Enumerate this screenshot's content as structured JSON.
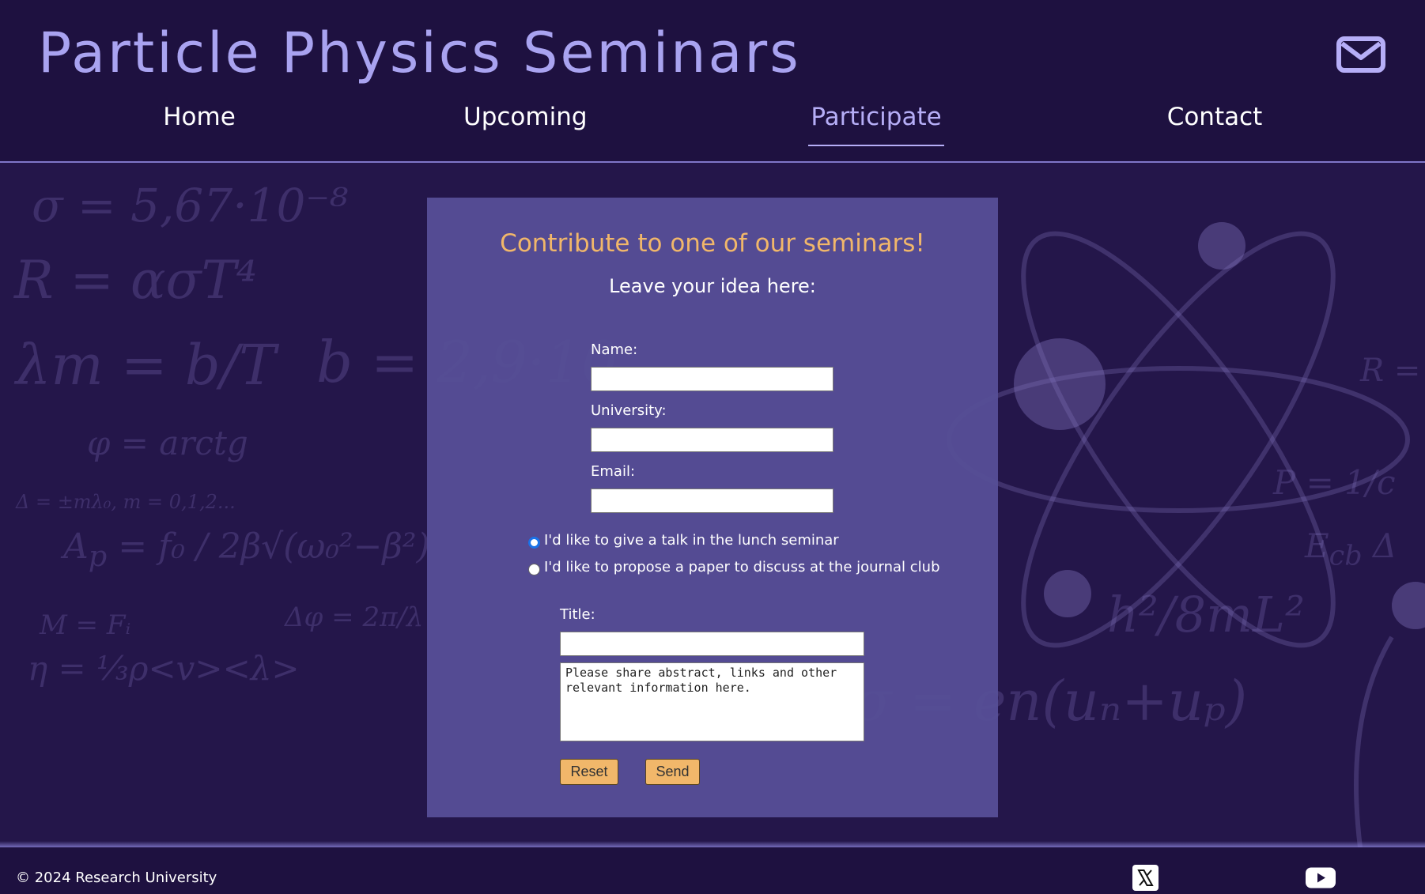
{
  "header": {
    "site_title": "Particle Physics Seminars",
    "mail_icon": "envelope-icon"
  },
  "nav": {
    "items": [
      {
        "label": "Home",
        "active": false
      },
      {
        "label": "Upcoming",
        "active": false
      },
      {
        "label": "Participate",
        "active": true
      },
      {
        "label": "Contact",
        "active": false
      }
    ]
  },
  "form": {
    "heading": "Contribute to one of our seminars!",
    "subheading": "Leave your idea here:",
    "name_label": "Name:",
    "name_value": "",
    "university_label": "University:",
    "university_value": "",
    "email_label": "Email:",
    "email_value": "",
    "radio_options": [
      {
        "label": "I'd like to give a talk in the lunch seminar",
        "checked": true
      },
      {
        "label": "I'd like to propose a paper to discuss at the journal club",
        "checked": false
      }
    ],
    "title_label": "Title:",
    "title_value": "",
    "details_placeholder": "Please share abstract, links and other relevant information here.",
    "reset_label": "Reset",
    "send_label": "Send"
  },
  "footer": {
    "copyright": "© 2024 Research University",
    "social_icons": [
      "x-twitter-icon",
      "youtube-icon"
    ]
  },
  "colors": {
    "background": "#1e1140",
    "accent": "#a9a3f0",
    "heading": "#f1b76a",
    "panel": "#564e96",
    "button": "#f1b76a"
  }
}
